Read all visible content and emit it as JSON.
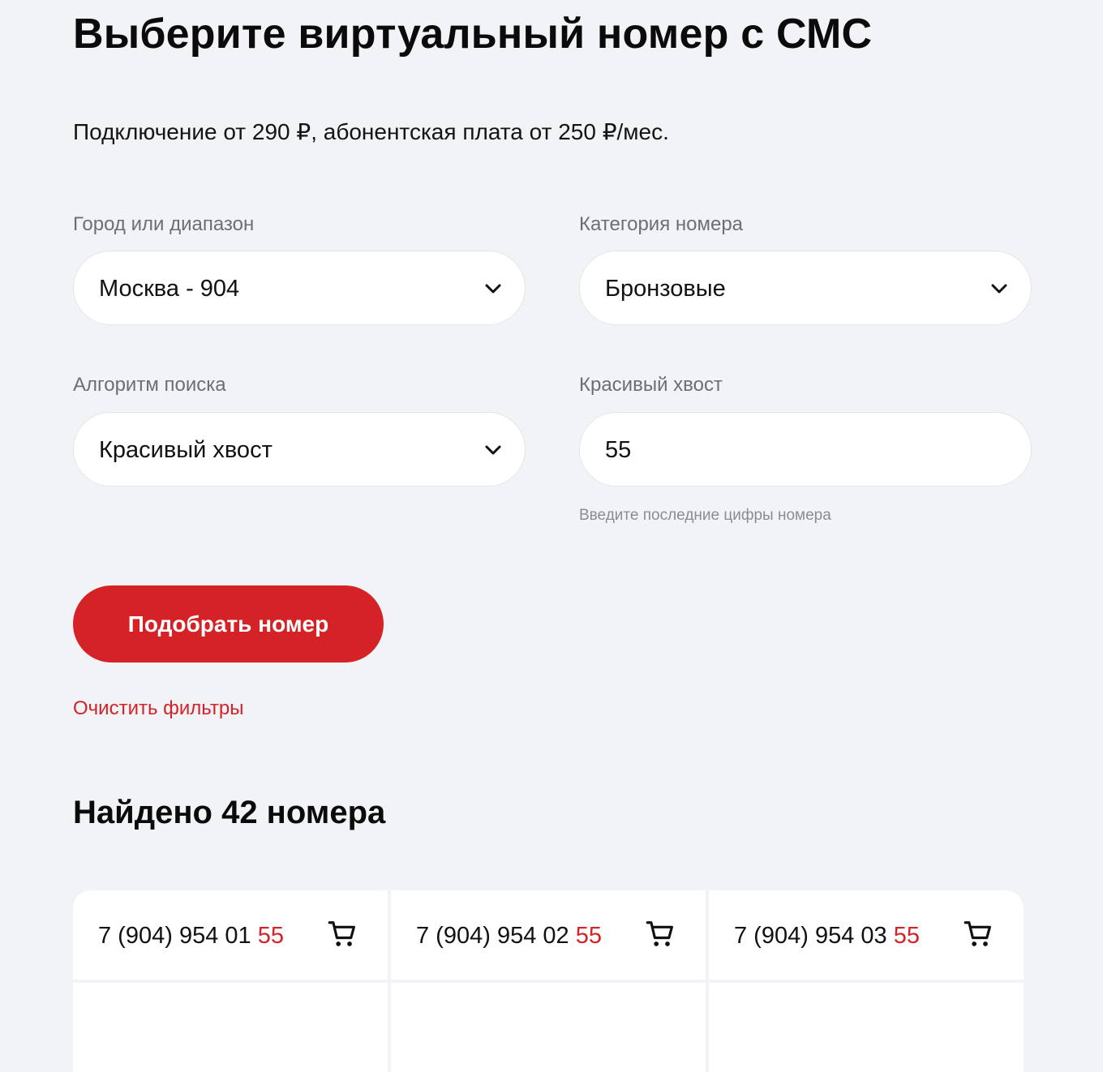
{
  "page": {
    "title": "Выберите виртуальный номер с СМС",
    "subtitle": "Подключение от 290 ₽, абонентская плата от 250 ₽/мес."
  },
  "filters": {
    "city": {
      "label": "Город или диапазон",
      "value": "Москва - 904"
    },
    "category": {
      "label": "Категория номера",
      "value": "Бронзовые"
    },
    "algorithm": {
      "label": "Алгоритм поиска",
      "value": "Красивый хвост"
    },
    "tail": {
      "label": "Красивый хвост",
      "value": "55",
      "hint": "Введите последние цифры номера"
    }
  },
  "actions": {
    "submit_label": "Подобрать номер",
    "clear_label": "Очистить фильтры"
  },
  "results": {
    "title": "Найдено 42 номера",
    "numbers": [
      {
        "prefix": "7 (904) 954 01 ",
        "tail": "55"
      },
      {
        "prefix": "7 (904) 954 02 ",
        "tail": "55"
      },
      {
        "prefix": "7 (904) 954 03 ",
        "tail": "55"
      }
    ]
  },
  "icons": {
    "dropdown": "chevron-down-icon",
    "cart": "cart-icon"
  },
  "colors": {
    "accent": "#d42226",
    "background": "#f2f3f7",
    "text": "#111111",
    "label": "#6d6e73"
  }
}
